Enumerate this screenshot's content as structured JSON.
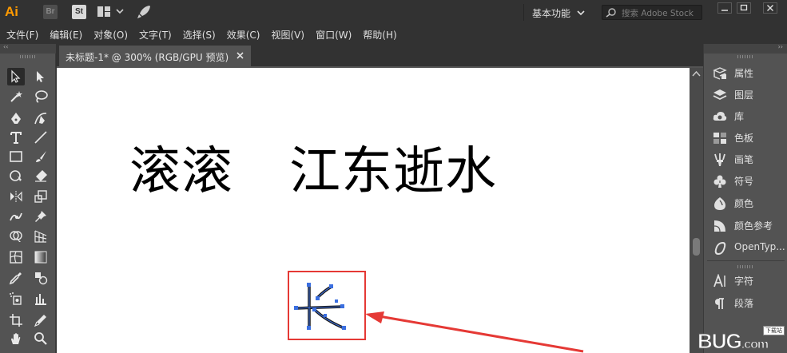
{
  "app": {
    "logo": "Ai",
    "bridge_label": "Br",
    "stock_label": "St"
  },
  "workspace": {
    "label": "基本功能"
  },
  "search": {
    "placeholder": "搜索 Adobe Stock"
  },
  "menu": {
    "items": [
      "文件(F)",
      "编辑(E)",
      "对象(O)",
      "文字(T)",
      "选择(S)",
      "效果(C)",
      "视图(V)",
      "窗口(W)",
      "帮助(H)"
    ]
  },
  "document": {
    "tab_title": "未标题-1* @ 300% (RGB/GPU 预览)"
  },
  "canvas": {
    "line1": "滚滚",
    "line2": "江东逝水"
  },
  "right_panel": {
    "items": [
      {
        "label": "属性",
        "icon": "properties-icon"
      },
      {
        "label": "图层",
        "icon": "layers-icon"
      },
      {
        "label": "库",
        "icon": "libraries-icon"
      },
      {
        "label": "色板",
        "icon": "swatches-icon"
      },
      {
        "label": "画笔",
        "icon": "brushes-icon"
      },
      {
        "label": "符号",
        "icon": "symbols-icon"
      },
      {
        "label": "颜色",
        "icon": "color-icon"
      },
      {
        "label": "颜色参考",
        "icon": "color-guide-icon"
      },
      {
        "label": "OpenTyp...",
        "icon": "opentype-icon"
      },
      {
        "label": "字符",
        "icon": "character-icon"
      },
      {
        "label": "段落",
        "icon": "paragraph-icon"
      }
    ]
  },
  "watermark": {
    "text": "BUG",
    "suffix": ".com",
    "badge": "下载站"
  },
  "colors": {
    "accent_orange": "#ff9a00",
    "highlight_red": "#e53935",
    "anchor_blue": "#3b6fe0"
  }
}
